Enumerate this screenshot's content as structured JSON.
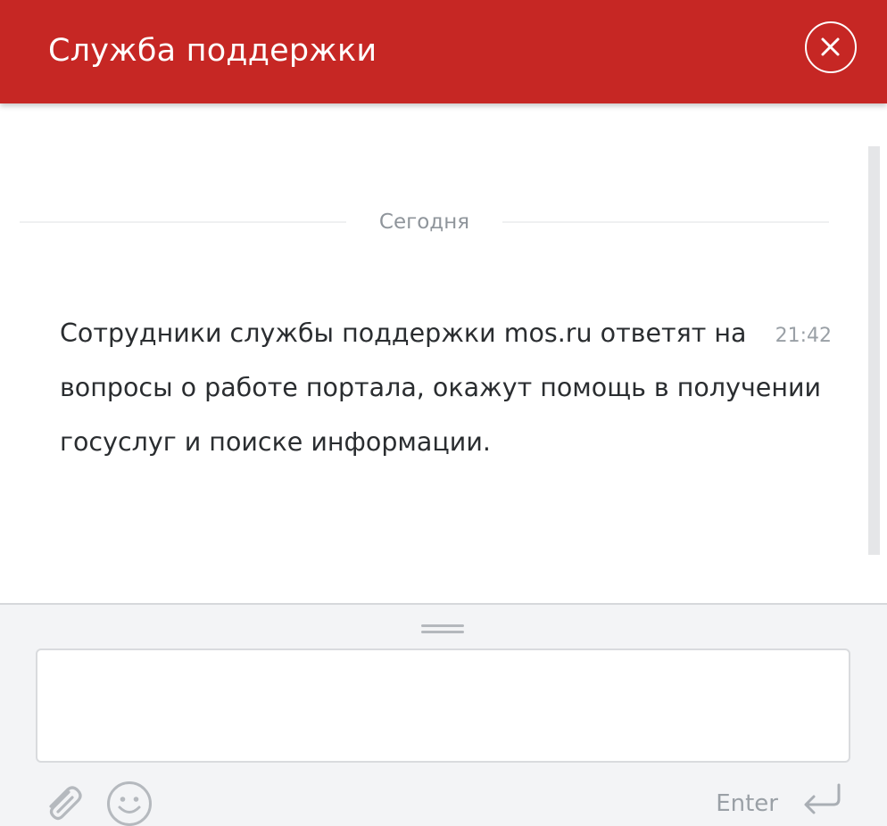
{
  "header": {
    "title": "Служба поддержки",
    "background_color": "#c62724",
    "close_icon": "close-circle-icon"
  },
  "chat": {
    "date_separator": "Сегодня",
    "messages": [
      {
        "text": "Сотрудники службы поддержки mos.ru ответят на вопросы о работе портала, окажут помощь в получении госуслуг и поиске информации.",
        "time": "21:42"
      }
    ]
  },
  "composer": {
    "input_value": "",
    "input_placeholder": "",
    "attach_icon": "paperclip-icon",
    "emoji_icon": "smiley-icon",
    "send_label": "Enter",
    "send_icon": "enter-return-icon",
    "resize_icon": "drag-handle-icon"
  }
}
